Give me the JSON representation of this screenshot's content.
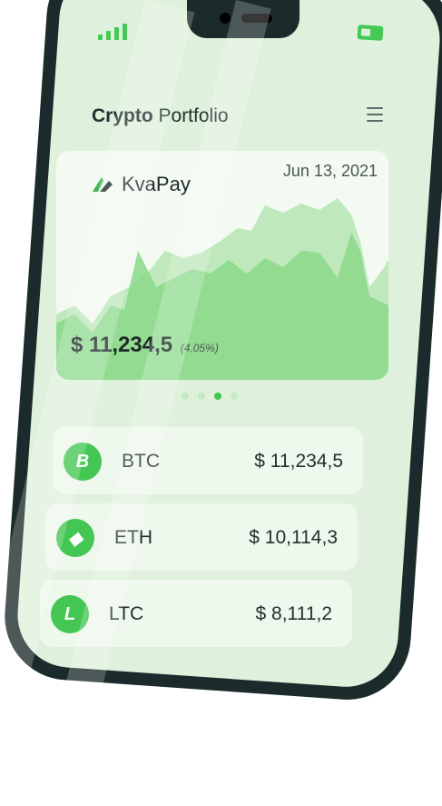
{
  "header": {
    "title_bold": "Crypto",
    "title_rest": " Portfolio"
  },
  "card": {
    "brand": "KvaPay",
    "date": "Jun 13, 2021",
    "balance": "$ 11,234,5",
    "change": "(4.05%)"
  },
  "pager": {
    "count": 4,
    "active_index": 2
  },
  "coins": [
    {
      "letter": "B",
      "symbol": "BTC",
      "value": "$ 11,234,5",
      "icon": "bitcoin-icon"
    },
    {
      "letter": "◆",
      "symbol": "ETH",
      "value": "$ 10,114,3",
      "icon": "ethereum-icon"
    },
    {
      "letter": "L",
      "symbol": "LTC",
      "value": "$ 8,111,2",
      "icon": "litecoin-icon"
    }
  ],
  "colors": {
    "accent": "#43c653",
    "screen": "#dff1dc",
    "frame": "#1b2a2a"
  }
}
